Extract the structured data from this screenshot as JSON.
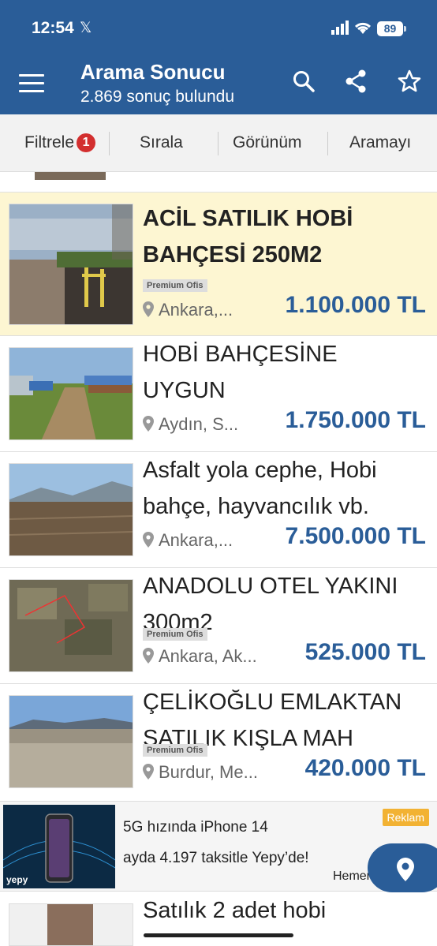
{
  "status_bar": {
    "time": "12:54",
    "x_glyph": "𝕏",
    "battery": "89"
  },
  "header": {
    "title": "Arama Sonucu",
    "subtitle": "2.869 sonuç bulundu",
    "icons": [
      "menu-icon",
      "search-icon",
      "share-icon",
      "star-icon"
    ]
  },
  "toolbar": {
    "filter_label": "Filtrele",
    "filter_count": "1",
    "sort_label": "Sırala",
    "view_label": "Görünüm",
    "search_label": "Aramayı"
  },
  "listings": [
    {
      "title": "ACİL SATILIK HOBİ BAHÇESİ 250M2",
      "premium": "Premium Ofis",
      "location": "Ankara,...",
      "price": "1.100.000 TL"
    },
    {
      "title": "HOBİ BAHÇESİNE UYGUN",
      "premium": "",
      "location": "Aydın, S...",
      "price": "1.750.000 TL"
    },
    {
      "title": "Asfalt yola cephe, Hobi bahçe, hayvancılık vb.",
      "premium": "",
      "location": "Ankara,...",
      "price": "7.500.000 TL"
    },
    {
      "title": "ANADOLU OTEL YAKINI 300m2",
      "premium": "Premium Ofis",
      "location": "Ankara, Ak...",
      "price": "525.000 TL"
    },
    {
      "title": "ÇELİKOĞLU EMLAKTAN SATILIK KIŞLA MAH",
      "premium": "Premium Ofis",
      "location": "Burdur, Me...",
      "price": "420.000 TL"
    },
    {
      "title": "Satılık 2 adet hobi"
    }
  ],
  "ad": {
    "line1": "5G hızında iPhone 14",
    "line2": "ayda 4.197 taksitle Yepy’de!",
    "tag": "Reklam",
    "partial": "Hemen",
    "logo": "yepy"
  },
  "colors": {
    "brand": "#2a5d98",
    "highlight": "#fdf6d2",
    "badge": "#d32f2f",
    "ad_tag": "#f2b233"
  }
}
